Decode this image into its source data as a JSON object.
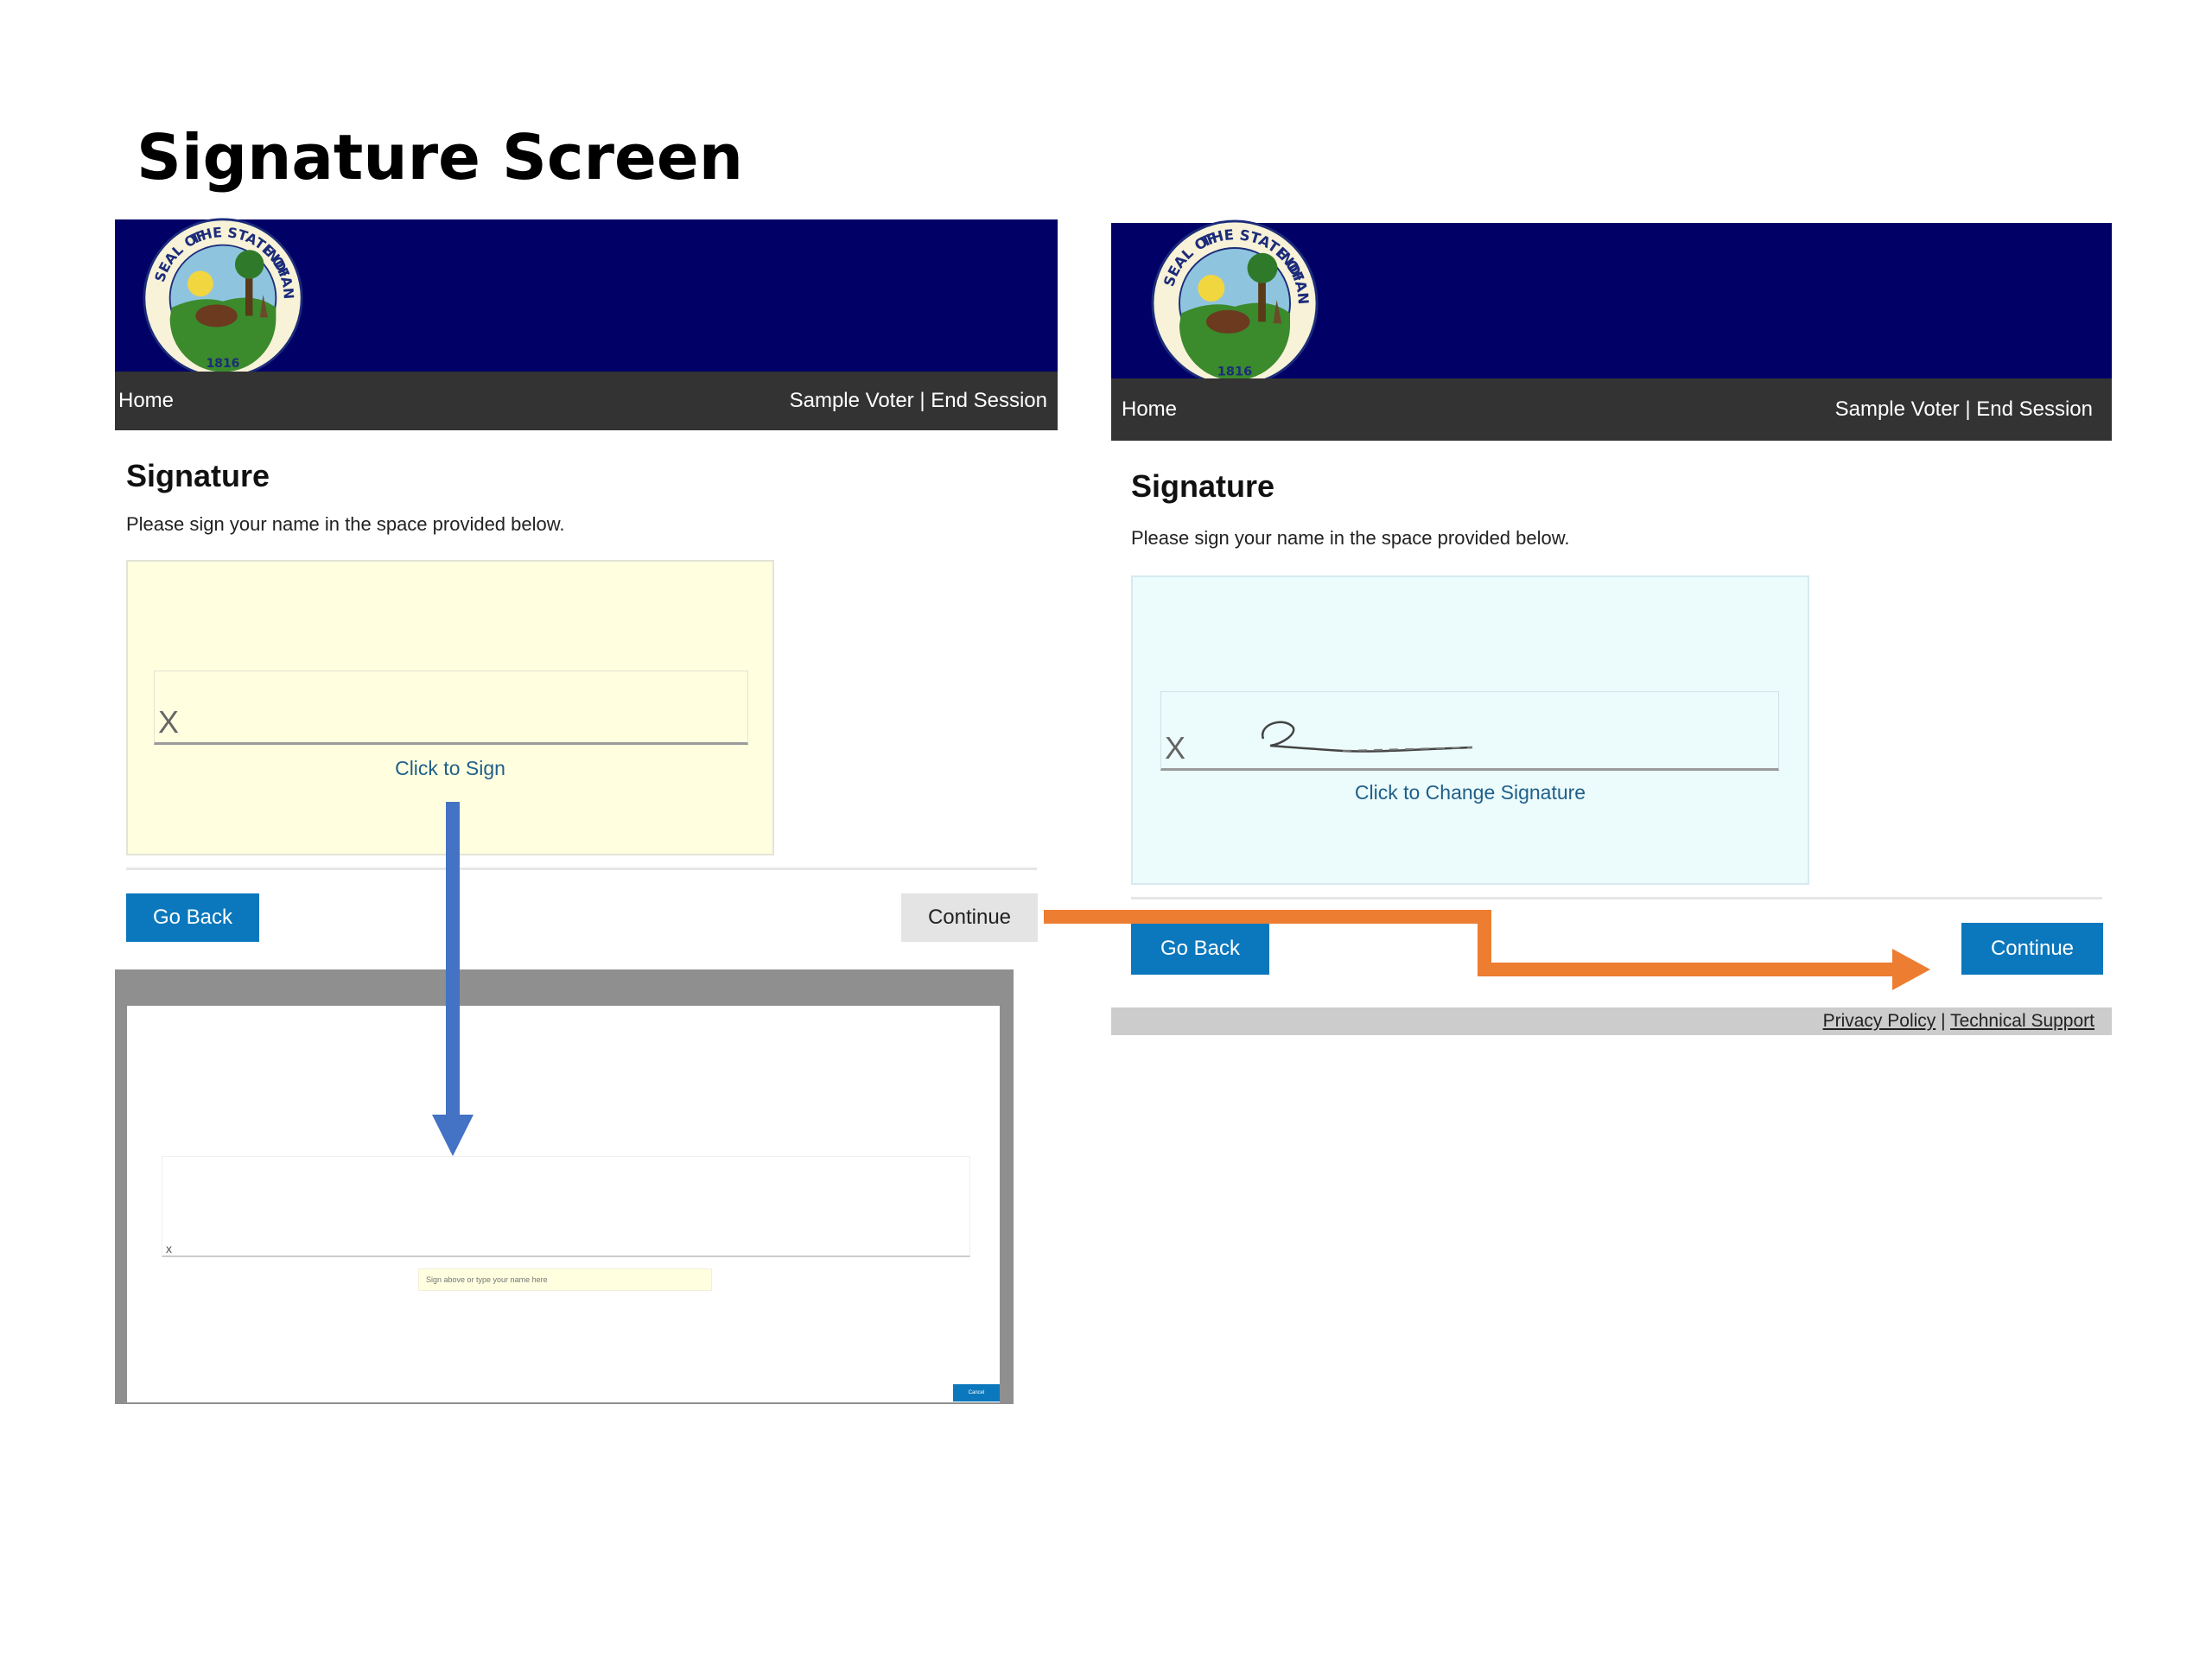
{
  "slide": {
    "title": "Signature Screen"
  },
  "colors": {
    "banner": "#000066",
    "navbar": "#333333",
    "button_primary": "#0b78bd",
    "button_disabled": "#e4e4e4",
    "sig_box_unsigned": "#ffffe0",
    "sig_box_signed": "#ecfbfb",
    "link": "#1f5f8a",
    "arrow_blue": "#4472c4",
    "arrow_orange": "#ed7d31"
  },
  "icons": {
    "seal": "indiana-state-seal-icon"
  },
  "left_screen": {
    "seal_text": {
      "top": "THE STATE OF",
      "left": "SEAL OF",
      "right": "INDIANA",
      "year": "1816"
    },
    "nav": {
      "home": "Home",
      "user_session": "Sample Voter | End Session"
    },
    "heading": "Signature",
    "instructions": "Please sign your name in the space provided below.",
    "signature": {
      "x_mark": "X",
      "link": "Click to Sign"
    },
    "buttons": {
      "back": "Go Back",
      "continue": "Continue"
    },
    "modal": {
      "x_mark": "x",
      "input_placeholder": "Sign above or type your name here",
      "cancel": "Cancel"
    }
  },
  "right_screen": {
    "seal_text": {
      "top": "THE STATE OF",
      "left": "SEAL OF",
      "right": "INDIANA",
      "year": "1816"
    },
    "nav": {
      "home": "Home",
      "user_session": "Sample Voter | End Session"
    },
    "heading": "Signature",
    "instructions": "Please sign your name in the space provided below.",
    "signature": {
      "x_mark": "X",
      "link": "Click to Change Signature"
    },
    "buttons": {
      "back": "Go Back",
      "continue": "Continue"
    },
    "footer": {
      "privacy": "Privacy Policy",
      "separator": "|",
      "support": "Technical Support"
    }
  }
}
